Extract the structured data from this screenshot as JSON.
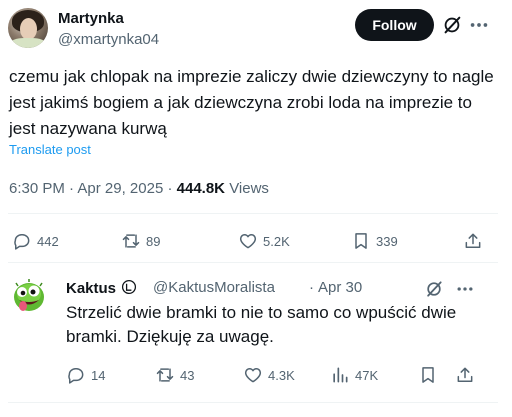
{
  "post": {
    "author_name": "Martynka",
    "author_handle": "@xmartynka04",
    "follow_label": "Follow",
    "text": "czemu jak chlopak na imprezie zaliczy dwie dziewczyny to nagle jest jakimś bogiem a jak dziewczyna zrobi loda na imprezie to jest nazywana kurwą",
    "translate_label": "Translate post",
    "time": "6:30 PM",
    "date": "Apr 29, 2025",
    "views_count": "444.8K",
    "views_label": "Views",
    "replies": "442",
    "reposts": "89",
    "likes": "5.2K",
    "bookmarks": "339"
  },
  "reply": {
    "author_name": "Kaktus",
    "author_handle": "@KaktusMoralista",
    "date": "Apr 30",
    "text": "Strzelić dwie bramki to nie to samo co wpuścić dwie bramki. Dziękuję za uwagę.",
    "replies": "14",
    "reposts": "43",
    "likes": "4.3K",
    "views": "47K"
  },
  "separator": "·",
  "icons": {
    "reply": "speech-bubble-icon",
    "repost": "repost-arrows-icon",
    "like": "heart-icon",
    "bookmark": "bookmark-icon",
    "share": "share-icon",
    "views": "bar-chart-icon",
    "grok": "grok-icon",
    "more": "more-dots-icon",
    "copyleft": "copyleft-icon"
  },
  "colors": {
    "text": "#0f1419",
    "secondary": "#536471",
    "link": "#1d9bf0",
    "button": "#0f1419",
    "divider": "#eff3f4"
  }
}
